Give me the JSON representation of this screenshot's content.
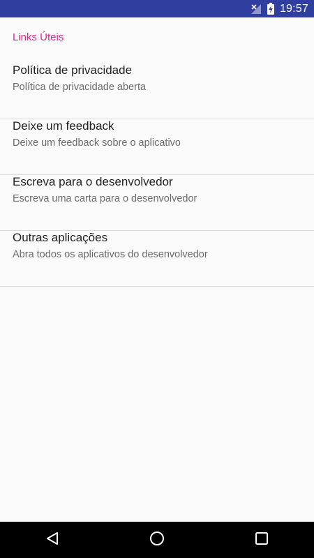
{
  "status_bar": {
    "time": "19:57",
    "icons": [
      "signal-off-icon",
      "battery-charging-icon"
    ],
    "background_color": "#303f9f"
  },
  "section": {
    "header": "Links Úteis",
    "accent_color": "#e91e8c"
  },
  "items": [
    {
      "title": "Política de privacidade",
      "summary": "Política de privacidade aberta"
    },
    {
      "title": "Deixe um feedback",
      "summary": "Deixe um feedback sobre o aplicativo"
    },
    {
      "title": "Escreva para o desenvolvedor",
      "summary": "Escreva uma carta para o desenvolvedor"
    },
    {
      "title": "Outras aplicações",
      "summary": "Abra todos os aplicativos do desenvolvedor"
    }
  ],
  "nav_bar": {
    "buttons": [
      "back-icon",
      "home-icon",
      "recents-icon"
    ]
  }
}
